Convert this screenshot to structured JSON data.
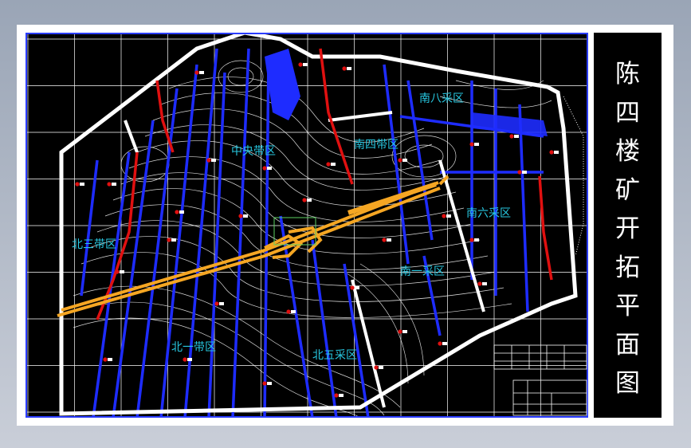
{
  "title": {
    "text": "陈四楼矿开拓平面图",
    "chars": [
      "陈",
      "四",
      "楼",
      "矿",
      "开",
      "拓",
      "平",
      "面",
      "图"
    ]
  },
  "zones": [
    {
      "id": "zone-zhongyang",
      "label": "中央带区"
    },
    {
      "id": "zone-nansi",
      "label": "南四带区"
    },
    {
      "id": "zone-nanba",
      "label": "南八采区"
    },
    {
      "id": "zone-nanliu",
      "label": "南六采区"
    },
    {
      "id": "zone-nanyi",
      "label": "南一采区"
    },
    {
      "id": "zone-beisan",
      "label": "北三带区"
    },
    {
      "id": "zone-beiyi",
      "label": "北一带区"
    },
    {
      "id": "zone-beiwu",
      "label": "北五采区"
    }
  ],
  "colors": {
    "background": "#000000",
    "grid": "#ffffff",
    "contour": "#ffffff",
    "roadway": "#1e2cff",
    "fault": "#e01010",
    "main_shaft": "#f5a623",
    "boundary": "#ffffff",
    "zone_label": "#27c7e0",
    "frame_blue": "#2a3cff"
  }
}
